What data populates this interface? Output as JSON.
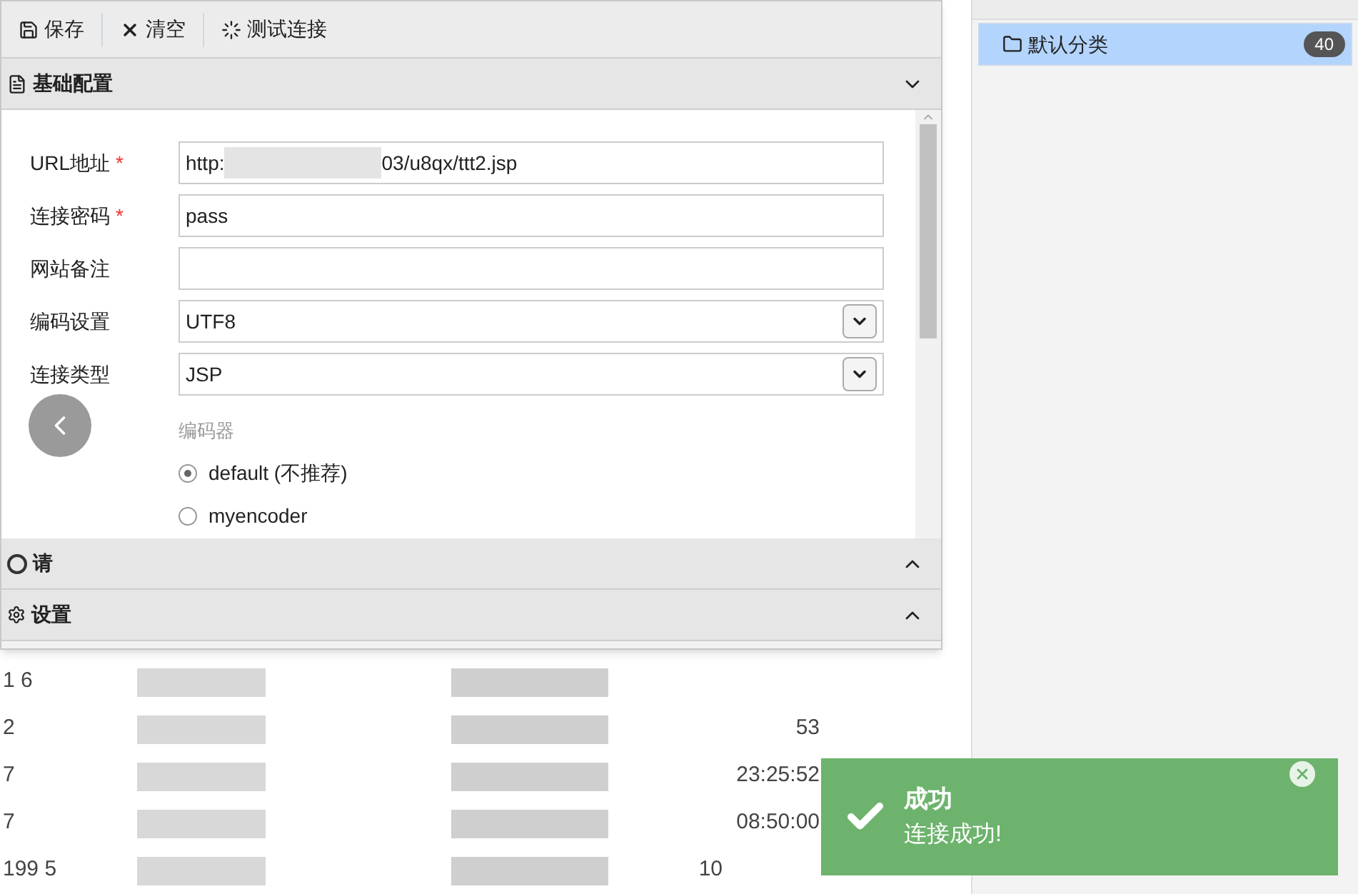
{
  "toolbar": {
    "buttons": [
      {
        "kind": "save",
        "label": "保存"
      },
      {
        "kind": "clear",
        "label": "清空"
      },
      {
        "kind": "test",
        "label": "测试连接"
      }
    ]
  },
  "sections": [
    {
      "kind": "basic",
      "title": "基础配置",
      "expanded": true
    },
    {
      "kind": "request",
      "title": "请",
      "expanded": false
    },
    {
      "kind": "other",
      "title": "设置",
      "expanded": false
    }
  ],
  "form": {
    "fields": [
      {
        "kind": "input",
        "label": "URL地址",
        "required_mark": "*",
        "value_prefix": "http:",
        "value_suffix": "03/u8qx/ttt2.jsp",
        "redacted": true
      },
      {
        "kind": "input",
        "label": "连接密码",
        "required_mark": "*",
        "value": "pass",
        "redacted": false
      },
      {
        "kind": "input",
        "label": "网站备注",
        "redacted": false
      },
      {
        "kind": "select",
        "label": "编码设置",
        "value": "UTF8",
        "redacted": false
      },
      {
        "kind": "select",
        "label": "连接类型",
        "value": "JSP",
        "redacted": false
      }
    ],
    "encoder_label": "编码器",
    "encoders": [
      {
        "label": "default (不推荐)",
        "selected": true
      },
      {
        "label": "myencoder",
        "selected": false
      }
    ]
  },
  "background_table": {
    "rows": [
      {
        "column_1": "1   6"
      },
      {
        "column_1": "2",
        "column_4": "53"
      },
      {
        "column_1": "7",
        "column_4": "23:25:52"
      },
      {
        "column_1": "7",
        "column_4": "08:50:00"
      },
      {
        "column_1": "199   5",
        "column_3": "10"
      }
    ]
  },
  "categories": [
    {
      "label": "默认分类",
      "count": "40",
      "selected": true
    }
  ],
  "notification": {
    "title": "成功",
    "message": "连接成功!"
  }
}
